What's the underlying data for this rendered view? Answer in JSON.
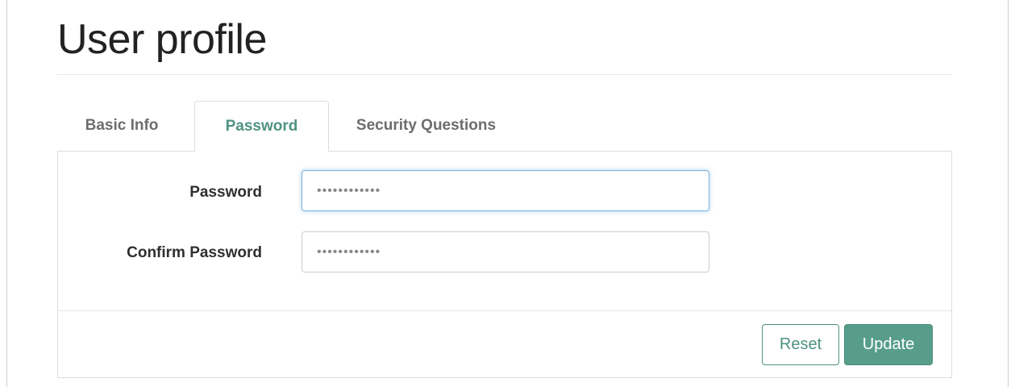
{
  "page": {
    "title": "User profile"
  },
  "tabs": [
    {
      "label": "Basic Info",
      "active": false
    },
    {
      "label": "Password",
      "active": true
    },
    {
      "label": "Security Questions",
      "active": false
    }
  ],
  "form": {
    "password": {
      "label": "Password",
      "value": "••••••••••••",
      "focused": true
    },
    "confirm_password": {
      "label": "Confirm Password",
      "value": "••••••••••••"
    }
  },
  "actions": {
    "reset_label": "Reset",
    "update_label": "Update"
  },
  "colors": {
    "accent": "#4e9282",
    "accent_fill": "#579d8a",
    "focus_ring": "#7fb3dd"
  }
}
